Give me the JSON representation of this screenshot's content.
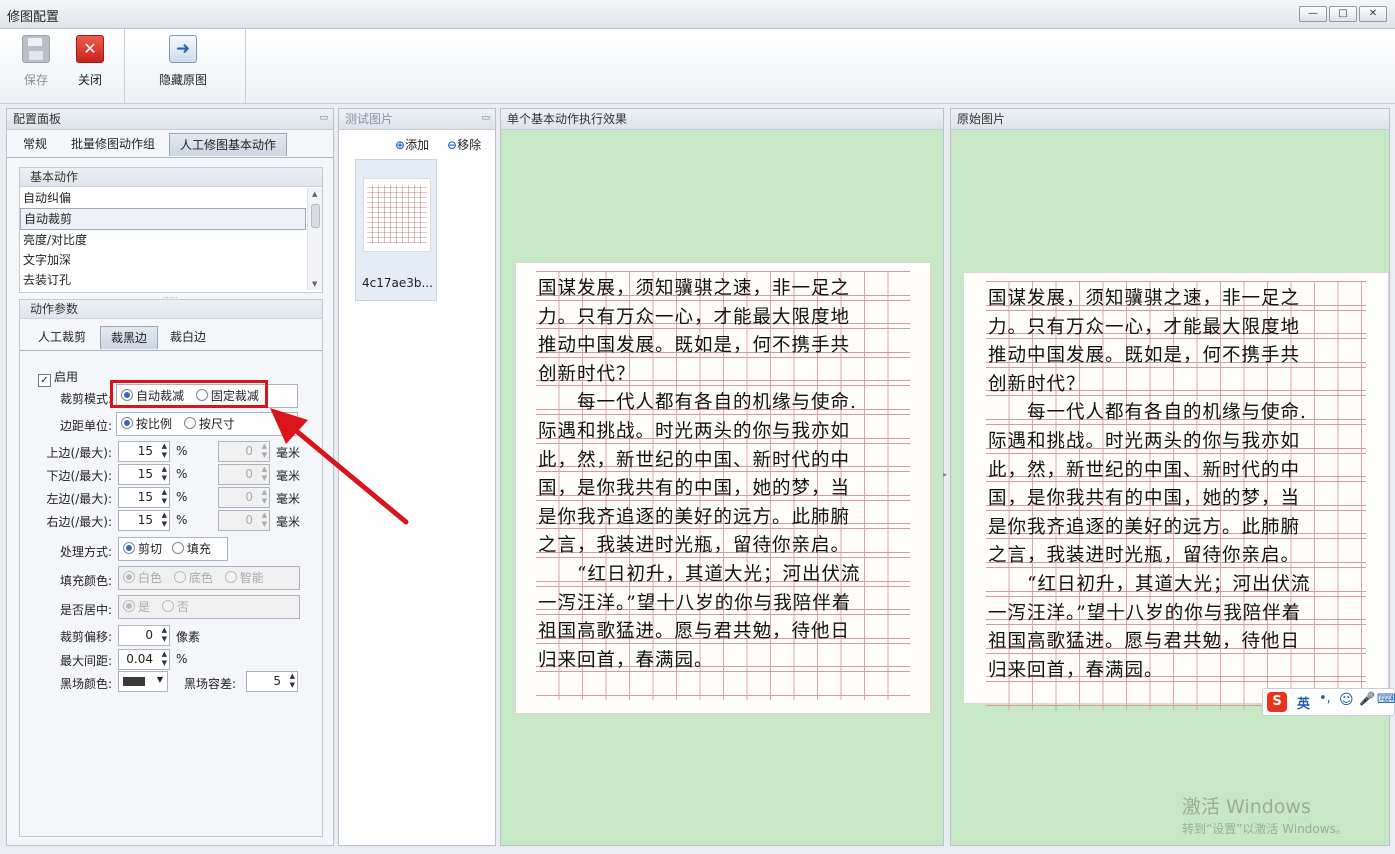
{
  "window": {
    "title": "修图配置",
    "btn_min": "—",
    "btn_max": "□",
    "btn_close": "✕"
  },
  "toolbar": {
    "save_label": "保存",
    "close_label": "关闭",
    "hide_original_label": "隐藏原图"
  },
  "config_panel": {
    "title": "配置面板",
    "tabs": [
      "常规",
      "批量修图动作组",
      "人工修图基本动作"
    ],
    "active_tab": "人工修图基本动作",
    "basic_actions": {
      "title": "基本动作",
      "items": [
        "自动纠偏",
        "自动裁剪",
        "亮度/对比度",
        "文字加深",
        "去装订孔"
      ],
      "selected": "自动裁剪"
    },
    "params": {
      "title": "动作参数",
      "tabs": [
        "人工裁剪",
        "裁黑边",
        "裁白边"
      ],
      "active_tab": "裁黑边",
      "enable_label": "启用",
      "enable_checked": true,
      "crop_mode": {
        "label": "裁剪模式:",
        "options": [
          "自动裁减",
          "固定裁减"
        ],
        "selected": "自动裁减"
      },
      "margin_unit": {
        "label": "边距单位:",
        "options": [
          "按比例",
          "按尺寸"
        ],
        "selected": "按比例"
      },
      "edges": [
        {
          "label": "上边(/最大):",
          "value": "15",
          "unit": "%",
          "mm_value": "0",
          "mm_unit": "毫米"
        },
        {
          "label": "下边(/最大):",
          "value": "15",
          "unit": "%",
          "mm_value": "0",
          "mm_unit": "毫米"
        },
        {
          "label": "左边(/最大):",
          "value": "15",
          "unit": "%",
          "mm_value": "0",
          "mm_unit": "毫米"
        },
        {
          "label": "右边(/最大):",
          "value": "15",
          "unit": "%",
          "mm_value": "0",
          "mm_unit": "毫米"
        }
      ],
      "process_mode": {
        "label": "处理方式:",
        "options": [
          "剪切",
          "填充"
        ],
        "selected": "剪切"
      },
      "fill_color": {
        "label": "填充颜色:",
        "options": [
          "白色",
          "底色",
          "智能"
        ],
        "selected": "白色"
      },
      "center": {
        "label": "是否居中:",
        "options": [
          "是",
          "否"
        ],
        "selected": "是"
      },
      "crop_offset": {
        "label": "裁剪偏移:",
        "value": "0",
        "unit": "像素"
      },
      "max_gap": {
        "label": "最大间距:",
        "value": "0.04",
        "unit": "%"
      },
      "black_color": {
        "label": "黑场颜色:",
        "color": "#3a3a3a"
      },
      "black_tolerance": {
        "label": "黑场容差:",
        "value": "5"
      }
    }
  },
  "test_panel": {
    "title": "测试图片",
    "add_label": "添加",
    "remove_label": "移除",
    "thumb_caption": "4c17ae3b..."
  },
  "result_panel": {
    "title": "单个基本动作执行效果"
  },
  "original_panel": {
    "title": "原始图片"
  },
  "document_lines": [
    "国谋发展，须知骥骐之速，非一足之",
    "力。只有万众一心，才能最大限度地",
    "推动中国发展。既如是，何不携手共",
    "创新时代？",
    "　　每一代人都有各自的机缘与使命.",
    "际遇和挑战。时光两头的你与我亦如",
    "此，然，新世纪的中国、新时代的中",
    "国，是你我共有的中国，她的梦，当",
    "是你我齐追逐的美好的远方。此肺腑",
    "之言，我装进时光瓶，留待你亲启。",
    "　　“红日初升，其道大光；河出伏流",
    "一泻汪洋。”望十八岁的你与我陪伴着",
    "祖国高歌猛进。愿与君共勉，待他日",
    "归来回首，春满园。"
  ],
  "ime_toolbar": {
    "text": "英"
  },
  "watermark": {
    "line1": "激活 Windows",
    "line2": "转到“设置”以激活 Windows。"
  },
  "colors": {
    "canvas_bg": "#c7e8c5",
    "accent": "#3a68b4",
    "highlight": "#d9151b"
  }
}
